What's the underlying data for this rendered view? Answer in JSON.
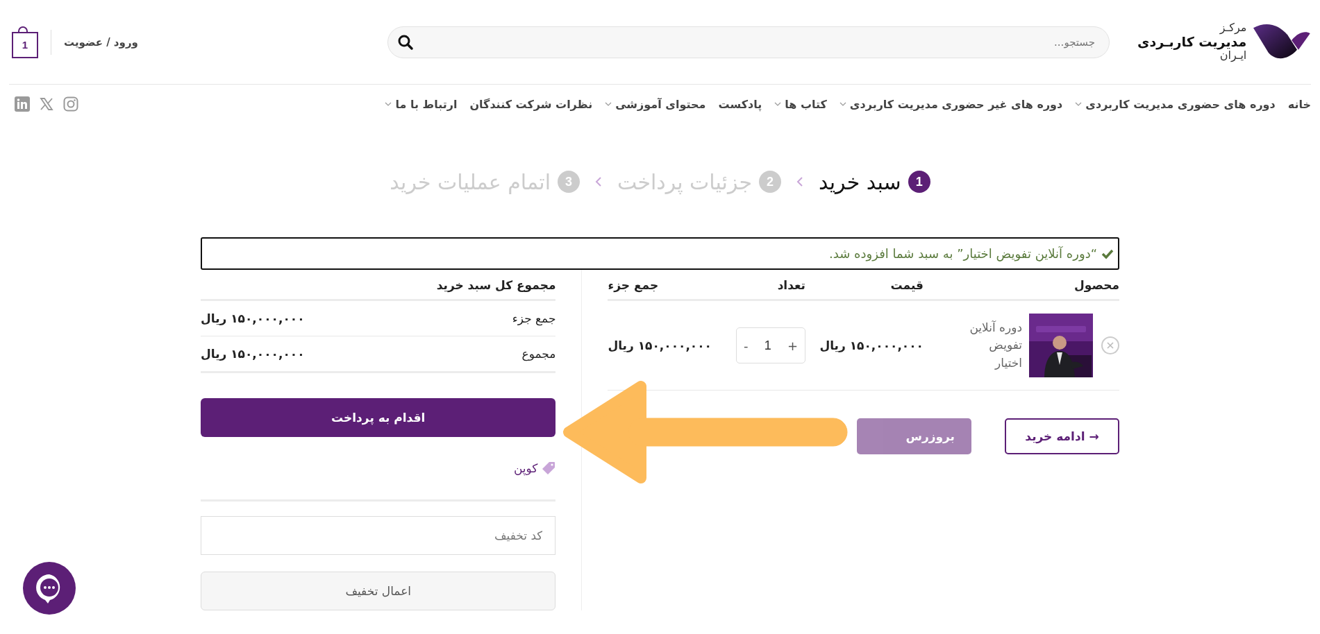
{
  "header": {
    "logo": [
      "مرکـز",
      "مدیریت کاربـردی",
      "ایـران"
    ],
    "search": {
      "placeholder": "جستجو..."
    },
    "account_link": "ورود / عضویت",
    "cart_count": "1"
  },
  "nav": {
    "items": [
      {
        "label": "خانه",
        "has_dropdown": false
      },
      {
        "label": "دوره های حضوری مدیریت کاربردی",
        "has_dropdown": true
      },
      {
        "label": "دوره های غیر حضوری مدیریت کاربردی",
        "has_dropdown": true
      },
      {
        "label": "کتاب ها",
        "has_dropdown": true
      },
      {
        "label": "پادکست",
        "has_dropdown": false
      },
      {
        "label": "محتوای آموزشی",
        "has_dropdown": true
      },
      {
        "label": "نظرات شرکت کنندگان",
        "has_dropdown": false
      },
      {
        "label": "ارتباط با ما",
        "has_dropdown": true
      }
    ]
  },
  "steps": [
    {
      "number": "1",
      "label": "سبد خرید",
      "selected": true
    },
    {
      "number": "2",
      "label": "جزئیات پرداخت",
      "selected": false
    },
    {
      "number": "3",
      "label": "اتمام عملیات خرید",
      "selected": false
    }
  ],
  "notice": "“دوره آنلاین تفویض اختیار” به سبد شما افزوده شد.",
  "cart_table": {
    "columns": [
      "محصول",
      "قیمت",
      "تعداد",
      "جمع جزء"
    ],
    "rows": [
      {
        "product": "دوره آنلاین تفویض اختیار",
        "price": "۱۵۰,۰۰۰,۰۰۰ ریال",
        "quantity": "1",
        "plus": "+",
        "minus": "-",
        "subtotal": "۱۵۰,۰۰۰,۰۰۰ ریال"
      }
    ]
  },
  "actions": [
    {
      "label": "→ ادامه خرید",
      "kind": "outline",
      "disabled": false
    },
    {
      "label": "بروزرس",
      "kind": "filled",
      "disabled": true
    }
  ],
  "totals": {
    "title": "مجموع کل سبد خرید",
    "rows": [
      {
        "label": "جمع جزء",
        "value": "۱۵۰,۰۰۰,۰۰۰ ریال"
      },
      {
        "label": "مجموع",
        "value": "۱۵۰,۰۰۰,۰۰۰ ریال"
      }
    ],
    "checkout": "اقدام به پرداخت",
    "coupon": {
      "heading": "کوپن",
      "placeholder": "کد تخفیف",
      "apply": "اعمال تخفیف"
    }
  }
}
